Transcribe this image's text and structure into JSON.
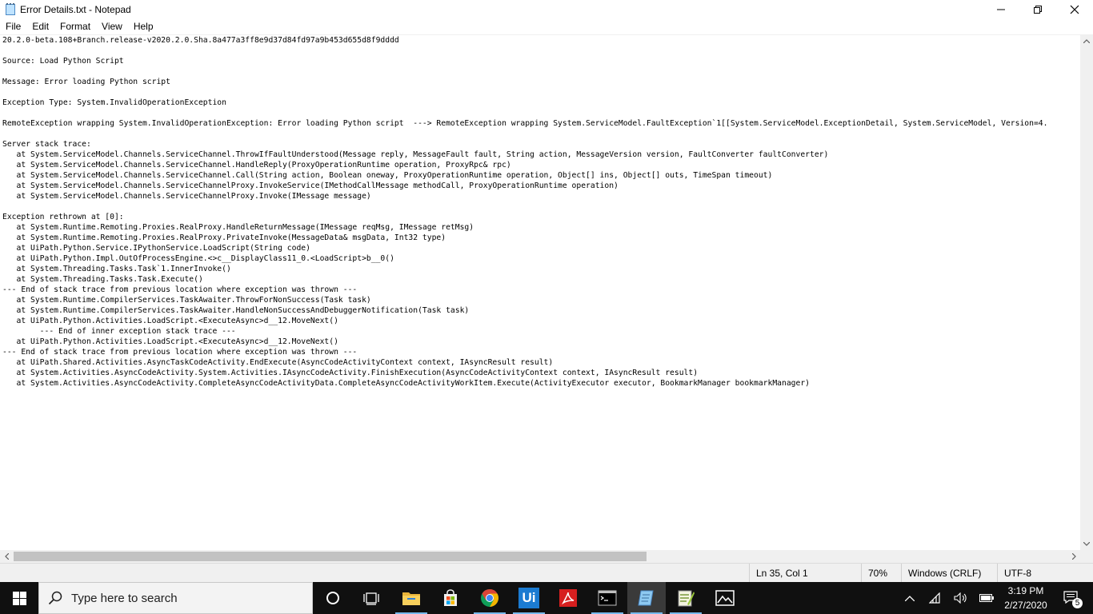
{
  "window": {
    "title": "Error Details.txt - Notepad",
    "minimize": "—",
    "maximize": "❐",
    "close": "✕"
  },
  "menu": {
    "items": [
      "File",
      "Edit",
      "Format",
      "View",
      "Help"
    ]
  },
  "document": {
    "lines": [
      "20.2.0-beta.108+Branch.release-v2020.2.0.Sha.8a477a3ff8e9d37d84fd97a9b453d655d8f9dddd",
      "",
      "Source: Load Python Script",
      "",
      "Message: Error loading Python script",
      "",
      "Exception Type: System.InvalidOperationException",
      "",
      "RemoteException wrapping System.InvalidOperationException: Error loading Python script  ---> RemoteException wrapping System.ServiceModel.FaultException`1[[System.ServiceModel.ExceptionDetail, System.ServiceModel, Version=4.",
      "",
      "Server stack trace:",
      "   at System.ServiceModel.Channels.ServiceChannel.ThrowIfFaultUnderstood(Message reply, MessageFault fault, String action, MessageVersion version, FaultConverter faultConverter)",
      "   at System.ServiceModel.Channels.ServiceChannel.HandleReply(ProxyOperationRuntime operation, ProxyRpc& rpc)",
      "   at System.ServiceModel.Channels.ServiceChannel.Call(String action, Boolean oneway, ProxyOperationRuntime operation, Object[] ins, Object[] outs, TimeSpan timeout)",
      "   at System.ServiceModel.Channels.ServiceChannelProxy.InvokeService(IMethodCallMessage methodCall, ProxyOperationRuntime operation)",
      "   at System.ServiceModel.Channels.ServiceChannelProxy.Invoke(IMessage message)",
      "",
      "Exception rethrown at [0]:",
      "   at System.Runtime.Remoting.Proxies.RealProxy.HandleReturnMessage(IMessage reqMsg, IMessage retMsg)",
      "   at System.Runtime.Remoting.Proxies.RealProxy.PrivateInvoke(MessageData& msgData, Int32 type)",
      "   at UiPath.Python.Service.IPythonService.LoadScript(String code)",
      "   at UiPath.Python.Impl.OutOfProcessEngine.<>c__DisplayClass11_0.<LoadScript>b__0()",
      "   at System.Threading.Tasks.Task`1.InnerInvoke()",
      "   at System.Threading.Tasks.Task.Execute()",
      "--- End of stack trace from previous location where exception was thrown ---",
      "   at System.Runtime.CompilerServices.TaskAwaiter.ThrowForNonSuccess(Task task)",
      "   at System.Runtime.CompilerServices.TaskAwaiter.HandleNonSuccessAndDebuggerNotification(Task task)",
      "   at UiPath.Python.Activities.LoadScript.<ExecuteAsync>d__12.MoveNext()",
      "        --- End of inner exception stack trace ---",
      "   at UiPath.Python.Activities.LoadScript.<ExecuteAsync>d__12.MoveNext()",
      "--- End of stack trace from previous location where exception was thrown ---",
      "   at UiPath.Shared.Activities.AsyncTaskCodeActivity.EndExecute(AsyncCodeActivityContext context, IAsyncResult result)",
      "   at System.Activities.AsyncCodeActivity.System.Activities.IAsyncCodeActivity.FinishExecution(AsyncCodeActivityContext context, IAsyncResult result)",
      "   at System.Activities.AsyncCodeActivity.CompleteAsyncCodeActivityData.CompleteAsyncCodeActivityWorkItem.Execute(ActivityExecutor executor, BookmarkManager bookmarkManager)"
    ]
  },
  "scrollbars": {
    "h_left": "<",
    "h_right": ">",
    "v_up": "^",
    "v_down": "v"
  },
  "status": {
    "position": "Ln 35, Col 1",
    "zoom": "70%",
    "line_ending": "Windows (CRLF)",
    "encoding": "UTF-8"
  },
  "taskbar": {
    "search_placeholder": "Type here to search",
    "time": "3:19 PM",
    "date": "2/27/2020",
    "notification_count": "5",
    "ui_label": "Ui"
  },
  "colors": {
    "taskbar": "#101010",
    "uipath": "#1b7bd1",
    "acrobat": "#d61f1f",
    "chrome_red": "#db4437",
    "chrome_green": "#0f9d58",
    "chrome_yellow": "#f4b400",
    "chrome_blue": "#4285f4"
  }
}
